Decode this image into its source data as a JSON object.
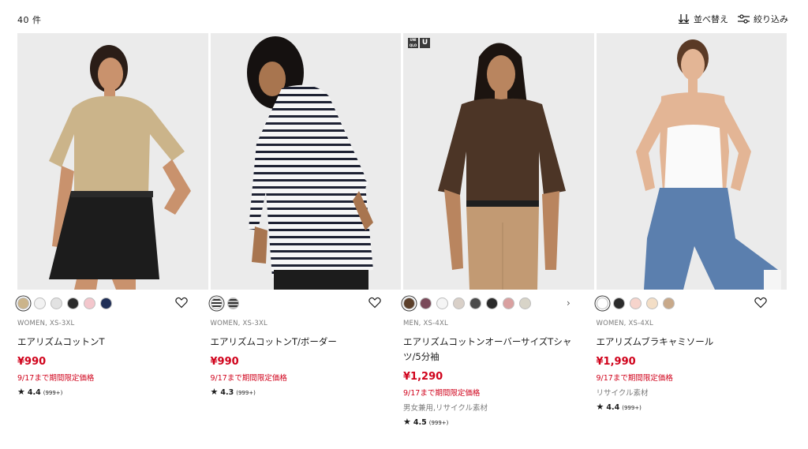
{
  "header": {
    "count": "40 件",
    "sort_label": "並べ替え",
    "filter_label": "絞り込み"
  },
  "products": [
    {
      "meta": "WOMEN, XS-3XL",
      "title": "エアリズムコットンT",
      "price": "¥990",
      "promo": "9/17まで期間限定価格",
      "extra": "",
      "rating": "4.4",
      "reviews": "(999+)",
      "swatches": [
        "#cbb48a",
        "#f2f2f2",
        "#e2e2e2",
        "#2b2b2b",
        "#f3c6cc",
        "#1f2e56"
      ],
      "brand_badge": false
    },
    {
      "meta": "WOMEN, XS-3XL",
      "title": "エアリズムコットンT/ボーダー",
      "price": "¥990",
      "promo": "9/17まで期間限定価格",
      "extra": "",
      "rating": "4.3",
      "reviews": "(999+)",
      "swatches": [
        "stripe-white-black",
        "stripe-grey-black"
      ],
      "brand_badge": false
    },
    {
      "meta": "MEN, XS-4XL",
      "title": "エアリズムコットンオーバーサイズTシャツ/5分袖",
      "price": "¥1,290",
      "promo": "9/17まで期間限定価格",
      "extra": "男女兼用,リサイクル素材",
      "rating": "4.5",
      "reviews": "(999+)",
      "swatches": [
        "#5b3f2a",
        "#7a4a5a",
        "#f5f5f5",
        "#d9d0c8",
        "#4a4a4a",
        "#2a2a2a",
        "#d9a0a0",
        "#d8d4c8"
      ],
      "brand_badge": true,
      "badge_left": "UNI QLO",
      "badge_right": "U"
    },
    {
      "meta": "WOMEN, XS-4XL",
      "title": "エアリズムブラキャミソール",
      "price": "¥1,990",
      "promo": "9/17まで期間限定価格",
      "extra": "リサイクル素材",
      "rating": "4.4",
      "reviews": "(999+)",
      "swatches": [
        "#ffffff",
        "#2b2b2b",
        "#f6d4cc",
        "#f3dec6",
        "#c8a98a"
      ],
      "brand_badge": false
    }
  ],
  "colors": {
    "price_red": "#d0021b",
    "text": "#1b1b1b",
    "muted": "#7a7a7a"
  },
  "icons": {
    "sort": "sort-icon",
    "filter": "filter-icon",
    "favorite": "heart-icon",
    "star": "star-icon",
    "more": "chevron-right-icon"
  }
}
